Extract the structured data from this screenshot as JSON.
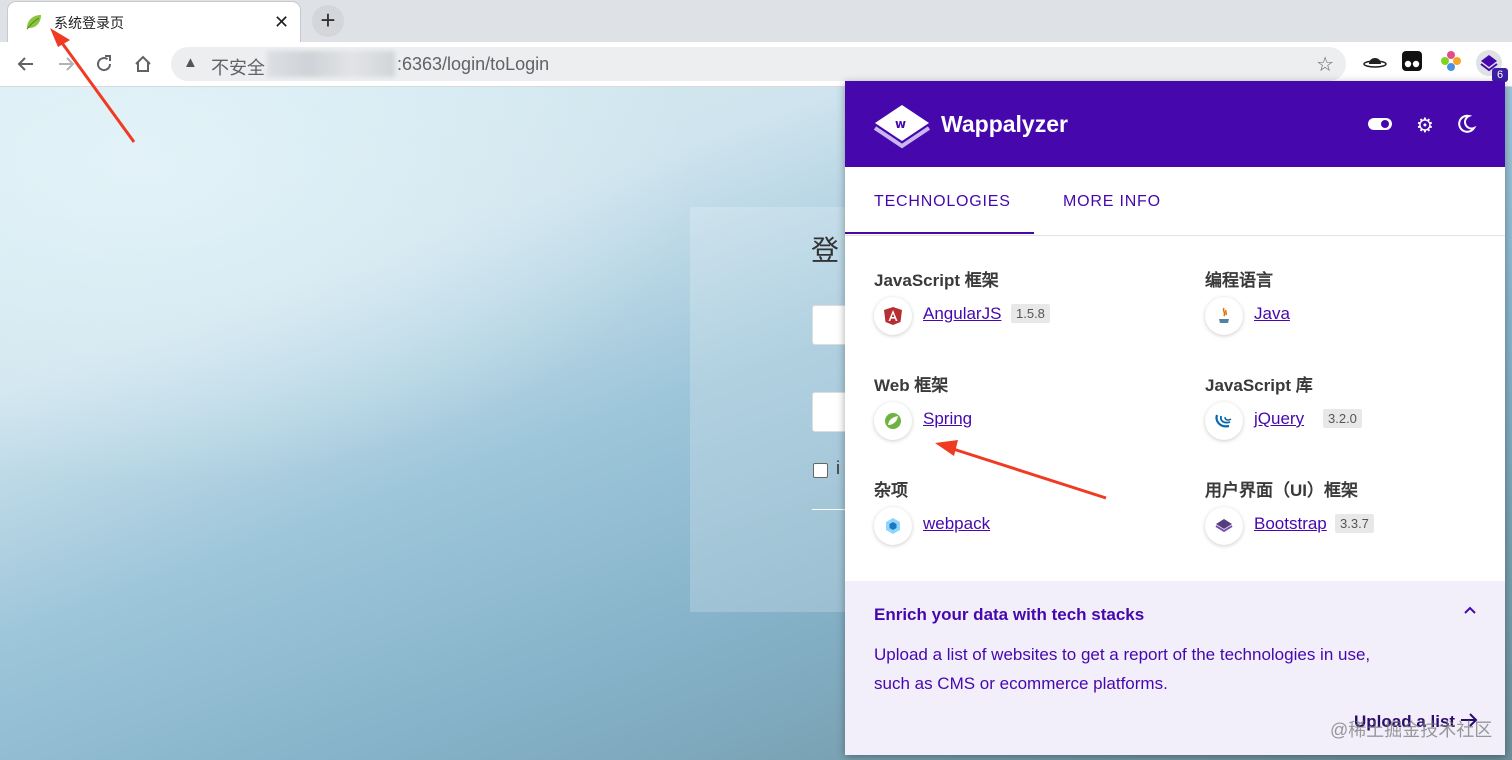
{
  "browser": {
    "tab_title": "系统登录页",
    "tab_close": "✕",
    "new_tab": "+",
    "insecure_label": "不安全",
    "url_suffix": ":6363/login/toLogin",
    "ext_badge": "6"
  },
  "login": {
    "title_partial": "登",
    "remember_partial": "i"
  },
  "wappalyzer": {
    "brand": "Wappalyzer",
    "tabs": [
      "TECHNOLOGIES",
      "MORE INFO"
    ],
    "categories": [
      {
        "title": "JavaScript 框架",
        "tech": "AngularJS",
        "version": "1.5.8"
      },
      {
        "title": "编程语言",
        "tech": "Java",
        "version": ""
      },
      {
        "title": "Web 框架",
        "tech": "Spring",
        "version": ""
      },
      {
        "title": "JavaScript 库",
        "tech": "jQuery",
        "version": "3.2.0"
      },
      {
        "title": "杂项",
        "tech": "webpack",
        "version": ""
      },
      {
        "title": "用户界面（UI）框架",
        "tech": "Bootstrap",
        "version": "3.3.7"
      }
    ],
    "footer": {
      "title": "Enrich your data with tech stacks",
      "text": "Upload a list of websites to get a report of the technologies in use, such as CMS or ecommerce platforms.",
      "link": "Upload a list"
    }
  },
  "watermark": "@稀土掘金技术社区",
  "colors": {
    "accent": "#4608ad",
    "annotation": "#f03a22"
  }
}
